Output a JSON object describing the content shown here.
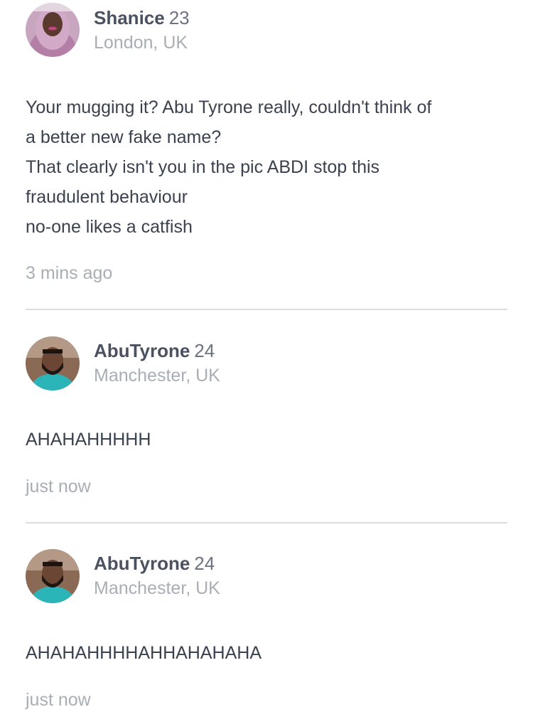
{
  "posts": [
    {
      "user": {
        "name": "Shanice",
        "age": "23",
        "location": "London, UK"
      },
      "message_lines": [
        "Your mugging it? Abu Tyrone really, couldn't think of",
        "a better new fake name?",
        "That clearly isn't you in the pic ABDI stop this",
        "fraudulent behaviour",
        "no-one likes a catfish"
      ],
      "timestamp": "3 mins ago"
    },
    {
      "user": {
        "name": "AbuTyrone",
        "age": "24",
        "location": "Manchester, UK"
      },
      "message_lines": [
        "AHAHAHHHHH"
      ],
      "timestamp": "just now"
    },
    {
      "user": {
        "name": "AbuTyrone",
        "age": "24",
        "location": "Manchester, UK"
      },
      "message_lines": [
        "AHAHAHHHHAHHAHAHAHA"
      ],
      "timestamp": "just now"
    }
  ]
}
